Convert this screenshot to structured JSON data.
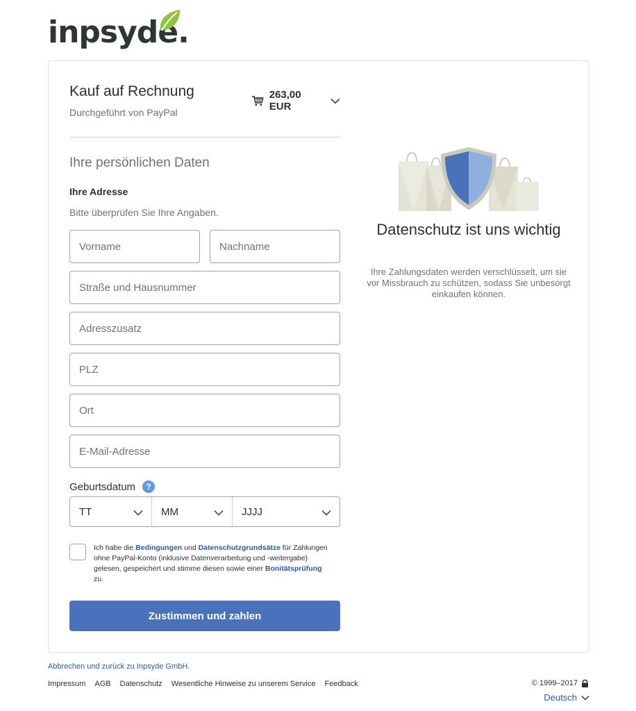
{
  "brand": {
    "name": "inpsyde.",
    "leaf_color": "#8cc63f"
  },
  "checkout": {
    "title": "Kauf auf Rechnung",
    "subtitle": "Durchgeführt von PayPal",
    "amount": "263,00 EUR"
  },
  "form": {
    "section_title": "Ihre persönlichen Daten",
    "address_title": "Ihre Adresse",
    "address_hint": "Bitte überprüfen Sie Ihre Angaben.",
    "first_name": {
      "placeholder": "Vorname",
      "value": ""
    },
    "last_name": {
      "placeholder": "Nachname",
      "value": ""
    },
    "street": {
      "placeholder": "Straße und Hausnummer",
      "value": ""
    },
    "address_extra": {
      "placeholder": "Adresszusatz",
      "value": ""
    },
    "zip": {
      "placeholder": "PLZ",
      "value": ""
    },
    "city": {
      "placeholder": "Ort",
      "value": ""
    },
    "email": {
      "placeholder": "E-Mail-Adresse",
      "value": ""
    },
    "dob_label": "Geburtsdatum",
    "help": "?",
    "dob_day": "TT",
    "dob_month": "MM",
    "dob_year": "JJJJ",
    "consent": {
      "t1": "Ich habe die ",
      "link_terms": "Bedingungen",
      "t2": " und ",
      "link_privacy": "Datenschutzgrundsätze",
      "t3": " für Zahlungen ohne PayPal-Konto (inklusive Datenverarbeitung und -weitergabe) gelesen, gespeichert und stimme diesen sowie einer ",
      "link_credit": "Bonitätsprüfung",
      "t4": " zu.",
      "checked": false
    },
    "submit_label": "Zustimmen und zahlen"
  },
  "privacy": {
    "title": "Datenschutz ist uns wichtig",
    "text": "Ihre Zahlungsdaten werden verschlüsselt, um sie vor Missbrauch zu schützen, sodass Sie unbesorgt einkaufen können.",
    "shield_color": "#4a72bb"
  },
  "footer": {
    "cancel_link": "Abbrechen und zurück zu Inpsyde GmbH.",
    "links": [
      "Impressum",
      "AGB",
      "Datenschutz",
      "Wesentliche Hinweise zu unserem Service",
      "Feedback"
    ],
    "copyright": "© 1999–2017",
    "language": "Deutsch"
  }
}
